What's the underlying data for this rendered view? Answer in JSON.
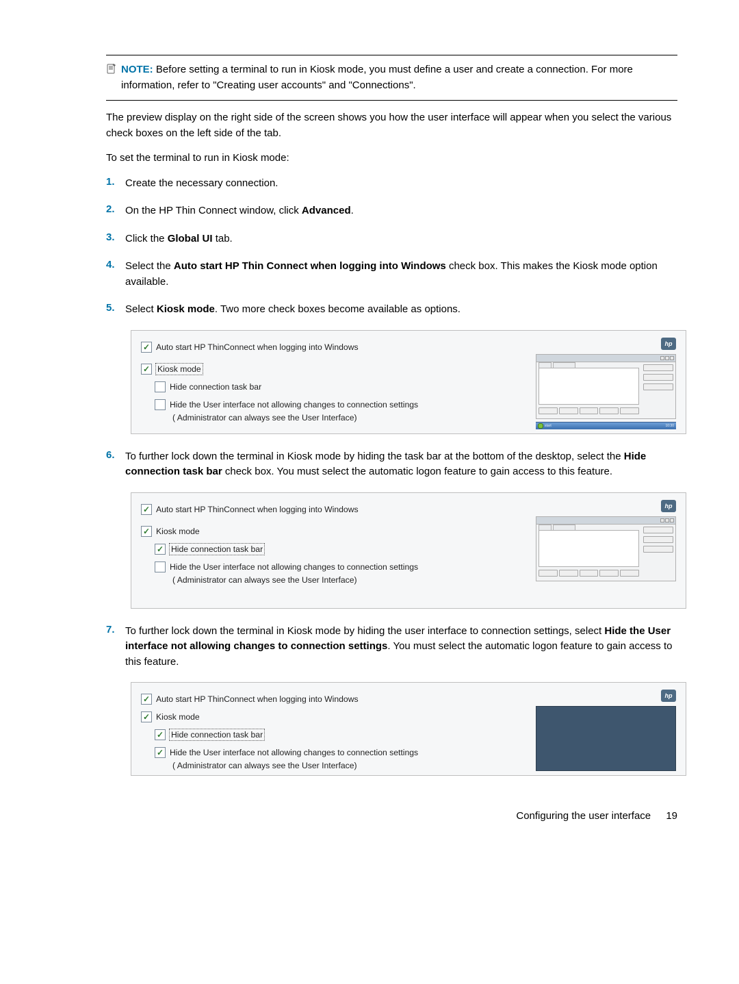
{
  "note": {
    "label": "NOTE:",
    "body": "Before setting a terminal to run in Kiosk mode, you must define a user and create a connection. For more information, refer to \"Creating user accounts\" and \"Connections\"."
  },
  "intro1": "The preview display on the right side of the screen shows you how the user interface will appear when you select the various check boxes on the left side of the tab.",
  "intro2": "To set the terminal to run in Kiosk mode:",
  "steps": {
    "s1": "Create the necessary connection.",
    "s2_a": "On the HP Thin Connect window, click ",
    "s2_b": "Advanced",
    "s2_c": ".",
    "s3_a": "Click the ",
    "s3_b": "Global UI",
    "s3_c": " tab.",
    "s4_a": "Select the ",
    "s4_b": "Auto start HP Thin Connect when logging into Windows",
    "s4_c": " check box. This makes the Kiosk mode option available.",
    "s5_a": "Select ",
    "s5_b": "Kiosk mode",
    "s5_c": ". Two more check boxes become available as options.",
    "s6_a": "To further lock down the terminal in Kiosk mode by hiding the task bar at the bottom of the desktop, select the ",
    "s6_b": "Hide connection task bar",
    "s6_c": " check box. You must select the automatic logon feature to gain access to this feature.",
    "s7_a": "To further lock down the terminal in Kiosk mode by hiding the user interface to connection settings, select ",
    "s7_b": "Hide the User interface not allowing changes to connection settings",
    "s7_c": ". You must select the automatic logon feature to gain access to this feature."
  },
  "figs": {
    "optAuto": "Auto start HP ThinConnect when logging into Windows",
    "optKiosk": "Kiosk mode",
    "optHideTask": "Hide connection task bar",
    "optHideUI": "Hide the User interface not allowing changes to connection settings",
    "adminNote": "( Administrator can always see the User Interface)"
  },
  "footer": {
    "text": "Configuring the user interface",
    "page": "19"
  },
  "preview": {
    "hp": "hp"
  }
}
